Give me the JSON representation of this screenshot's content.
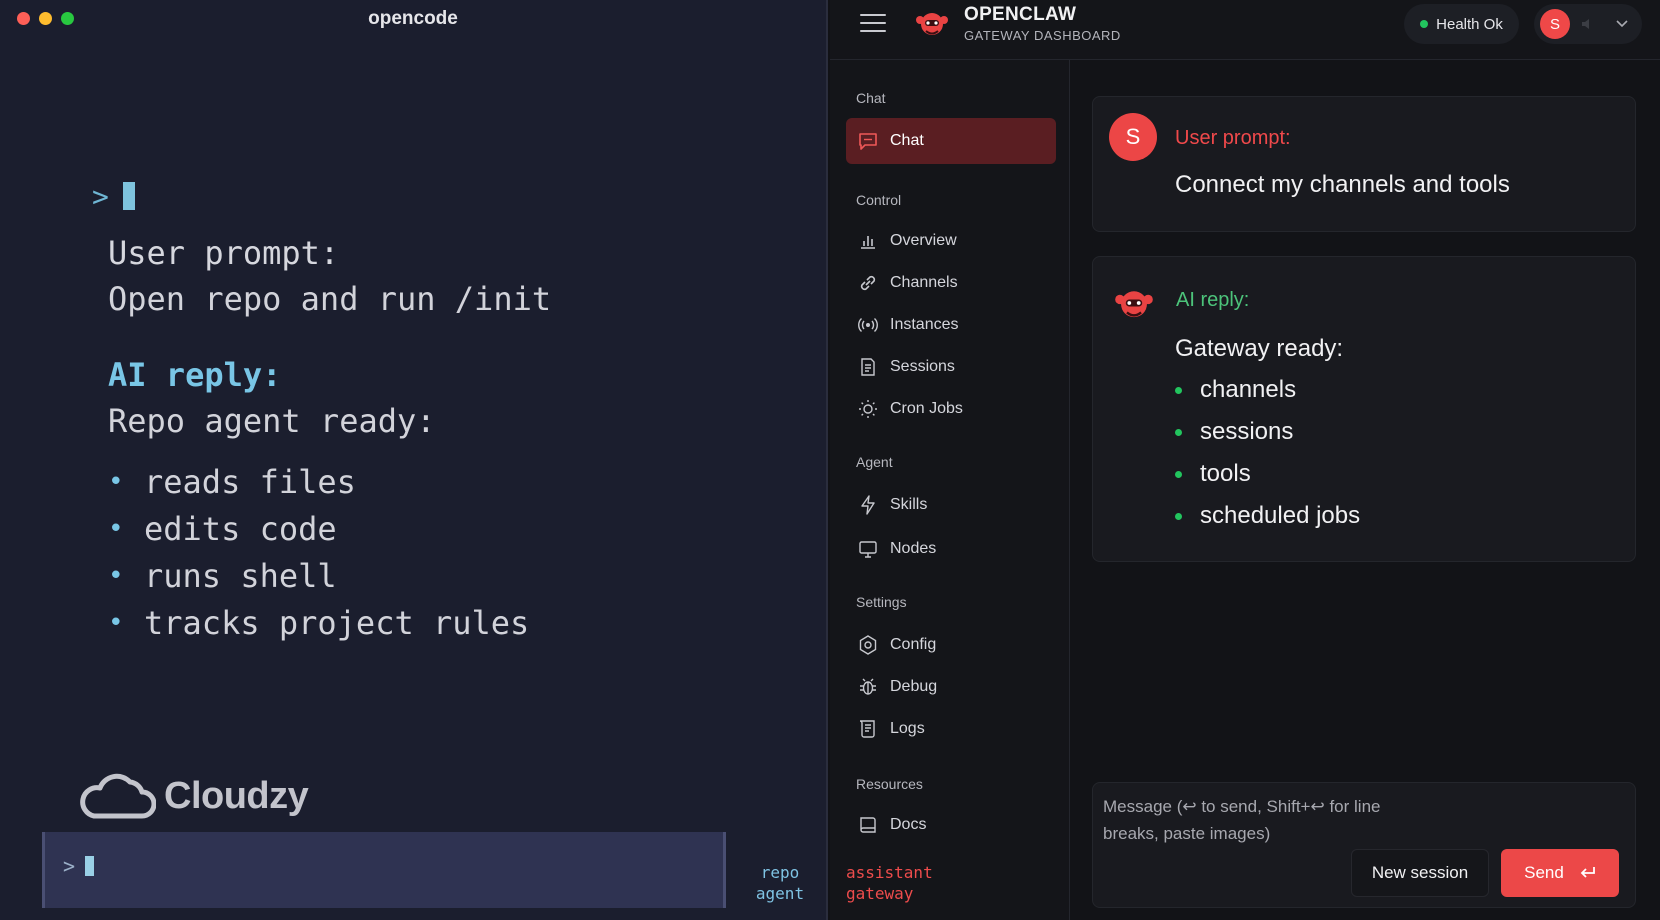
{
  "terminal": {
    "title": "opencode",
    "prompt_symbol": ">",
    "user_label": "User prompt:",
    "user_message": "Open repo and run /init",
    "ai_label": "AI reply:",
    "ai_message": "Repo agent ready:",
    "ai_items": [
      "reads files",
      "edits code",
      "runs shell",
      "tracks project rules"
    ],
    "bullet": "•",
    "watermark": "Cloudzy",
    "status_line1": "repo",
    "status_line2": "agent"
  },
  "dashboard": {
    "brand_title": "OPENCLAW",
    "brand_subtitle": "GATEWAY DASHBOARD",
    "health_label": "Health Ok",
    "avatar_letter": "S",
    "sidebar": {
      "sections": {
        "chat": "Chat",
        "control": "Control",
        "agent": "Agent",
        "settings": "Settings",
        "resources": "Resources"
      },
      "items": {
        "chat": "Chat",
        "overview": "Overview",
        "channels": "Channels",
        "instances": "Instances",
        "sessions": "Sessions",
        "cron_jobs": "Cron Jobs",
        "skills": "Skills",
        "nodes": "Nodes",
        "config": "Config",
        "debug": "Debug",
        "logs": "Logs",
        "docs": "Docs"
      },
      "status_line1": "assistant",
      "status_line2": "gateway"
    },
    "chat": {
      "user_avatar": "S",
      "user_label": "User prompt:",
      "user_message": "Connect my channels and tools",
      "ai_label": "AI reply:",
      "ai_message": "Gateway ready:",
      "ai_items": [
        "channels",
        "sessions",
        "tools",
        "scheduled jobs"
      ]
    },
    "composer": {
      "placeholder": "Message (↩ to send, Shift+↩ for line breaks, paste images)",
      "new_session_label": "New session",
      "send_label": "Send"
    }
  },
  "colors": {
    "terminal_bg": "#1b1e2e",
    "accent_cyan": "#79c6e6",
    "accent_red": "#ec4848",
    "accent_green": "#22c55e",
    "dashboard_bg": "#121317"
  }
}
